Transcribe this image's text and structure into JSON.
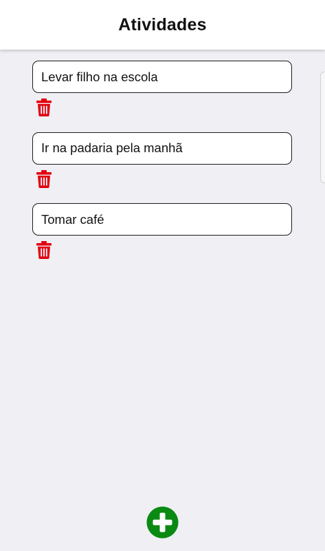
{
  "header": {
    "title": "Atividades"
  },
  "tasks": [
    {
      "text": "Levar filho na escola"
    },
    {
      "text": "Ir na padaria pela manhã"
    },
    {
      "text": "Tomar café"
    }
  ],
  "icons": {
    "delete": "trash-icon",
    "add": "plus-circle-icon"
  },
  "colors": {
    "delete": "#e3000f",
    "add": "#0a8a12",
    "background": "#efeff4"
  }
}
